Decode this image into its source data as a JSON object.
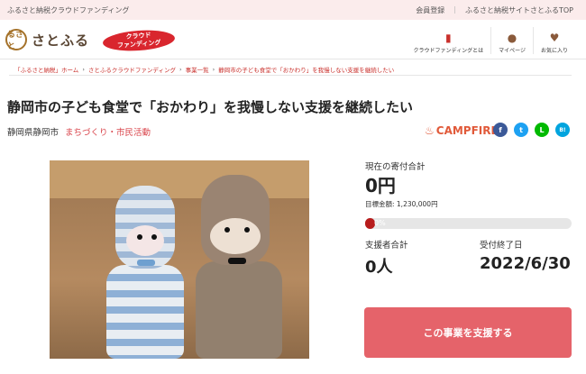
{
  "topbar": {
    "site_name": "ふるさと納税クラウドファンディング",
    "links": [
      "会員登録",
      "ふるさと納税サイトさとふるTOP"
    ]
  },
  "header": {
    "logo_mark": "るさと",
    "logo_text": "さとふる",
    "badge_line1": "クラウド",
    "badge_line2": "ファンディング",
    "nav": [
      {
        "label": "クラウドファンディングとは",
        "icon": "book-icon"
      },
      {
        "label": "マイページ",
        "icon": "user-icon"
      },
      {
        "label": "お気に入り",
        "icon": "heart-icon"
      }
    ]
  },
  "breadcrumb": [
    "「ふるさと納税」ホーム",
    "さとふるクラウドファンディング",
    "事業一覧",
    "静岡市の子ども食堂で「おかわり」を我慢しない支援を継続したい"
  ],
  "project": {
    "title": "静岡市の子ども食堂で「おかわり」を我慢しない支援を継続したい",
    "location": "静岡県静岡市",
    "category": "まちづくり・市民活動",
    "partner": "CAMPFIRE"
  },
  "social": {
    "facebook": "f",
    "twitter": "t",
    "line": "L",
    "hatena": "B!"
  },
  "stats": {
    "current_label": "現在の寄付合計",
    "current_amount": "0円",
    "target_label": "目標金額: 1,230,000円",
    "progress_percent": 0,
    "progress_text": "0%",
    "supporters_label": "支援者合計",
    "supporters": "0人",
    "deadline_label": "受付終了日",
    "deadline": "2022/6/30"
  },
  "cta": {
    "label": "この事業を支援する"
  },
  "colors": {
    "accent": "#d9262e",
    "cta": "#e5636a",
    "progress": "#b71c1c",
    "topbar": "#fbecec"
  }
}
